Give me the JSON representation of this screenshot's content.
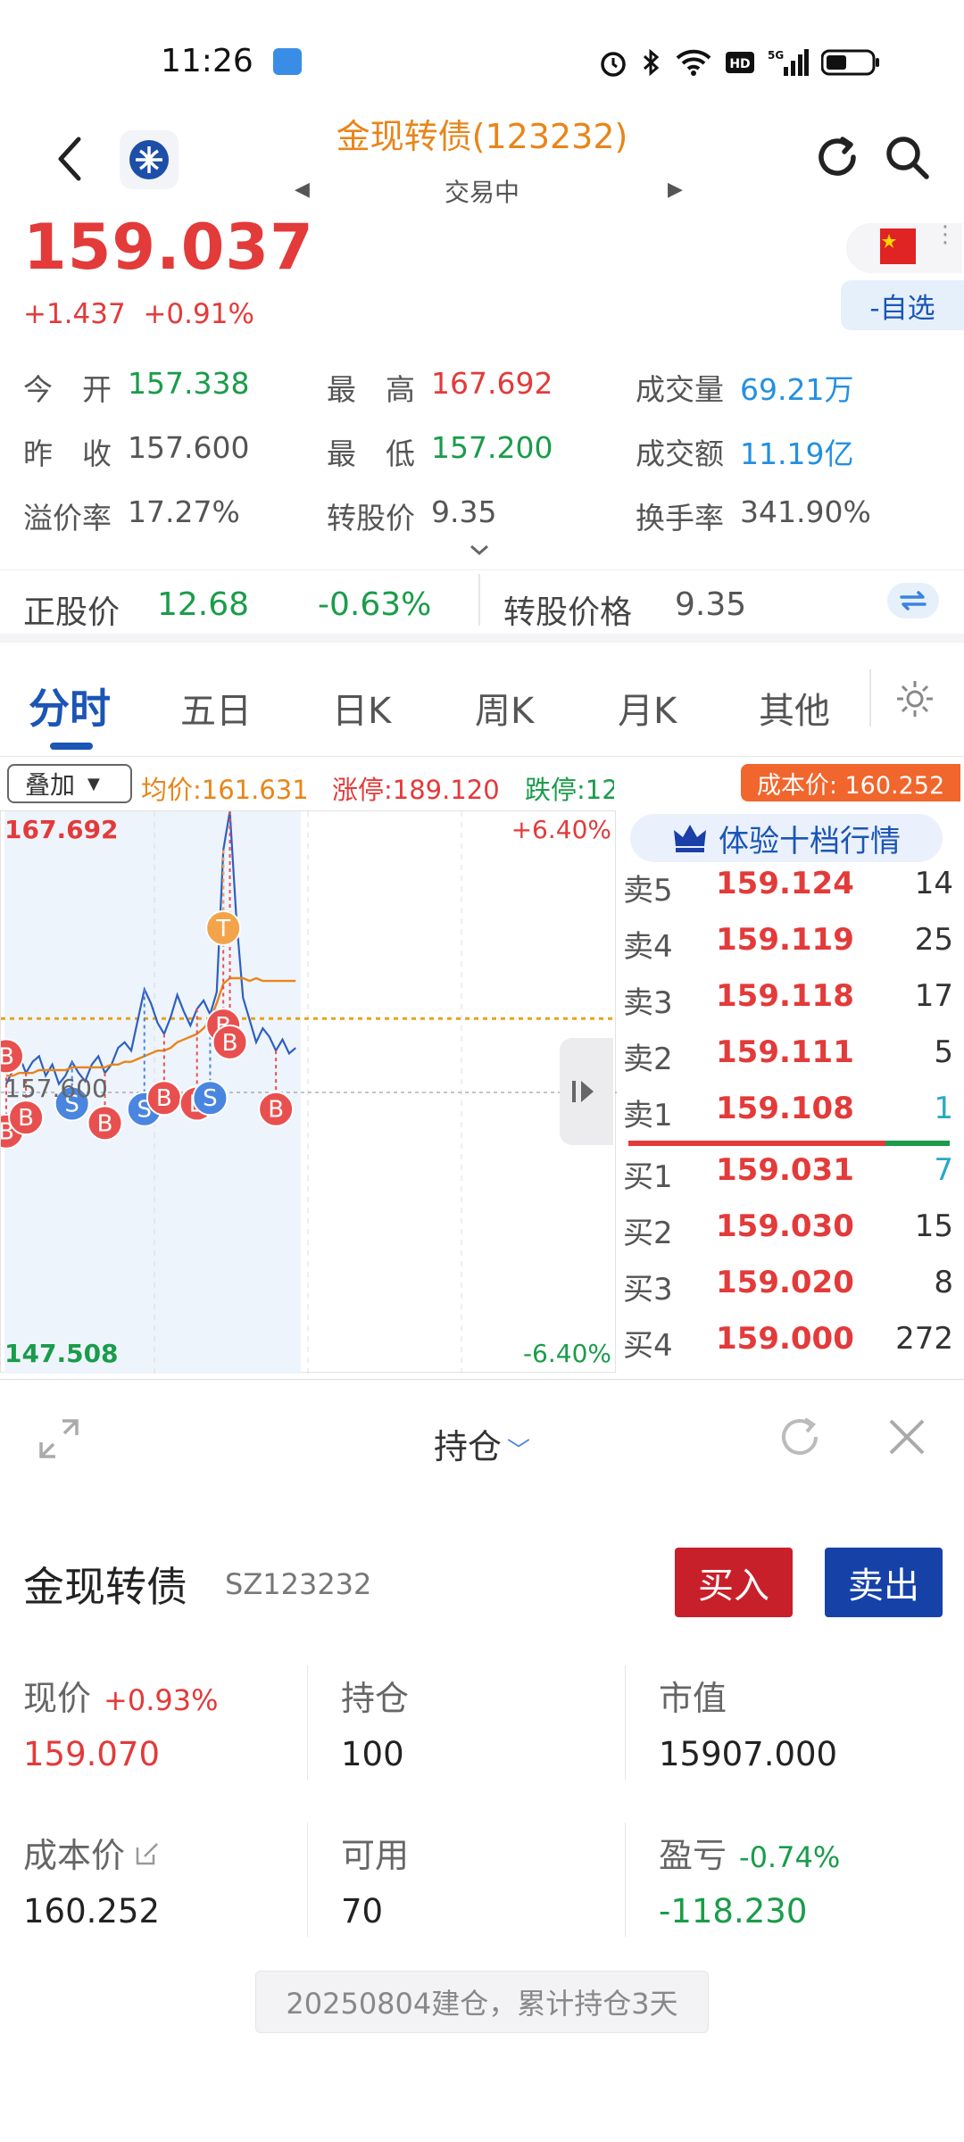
{
  "status_bar": {
    "time": "11:26"
  },
  "header": {
    "title": "金现转债(123232)",
    "subtitle": "交易中",
    "prev_arrow": "◀",
    "next_arrow": "▶"
  },
  "quote": {
    "price": "159.037",
    "change": "+1.437",
    "change_pct": "+0.91%",
    "watch_label": "-自选"
  },
  "stats": {
    "open_label": "今　开",
    "open": "157.338",
    "high_label": "最　高",
    "high": "167.692",
    "volume_label": "成交量",
    "volume": "69.21万",
    "prev_close_label": "昨　收",
    "prev_close": "157.600",
    "low_label": "最　低",
    "low": "157.200",
    "amount_label": "成交额",
    "amount": "11.19亿",
    "premium_label": "溢价率",
    "premium": "17.27%",
    "conv_price_label": "转股价",
    "conv_price": "9.35",
    "turnover_label": "换手率",
    "turnover": "341.90%"
  },
  "underlying": {
    "stock_price_label": "正股价",
    "stock_price": "12.68",
    "stock_change": "-0.63%",
    "conv_price_label": "转股价格",
    "conv_price": "9.35"
  },
  "tabs": [
    "分时",
    "五日",
    "日K",
    "周K",
    "月K",
    "其他"
  ],
  "chart_bar": {
    "overlay": "叠加",
    "avg_price": "均价:161.631",
    "limit_up": "涨停:189.120",
    "limit_down": "跌停:12",
    "cost_price": "成本价: 160.252"
  },
  "chart_data": {
    "type": "line",
    "y_max_label": "167.692",
    "y_min_label": "147.508",
    "y_mid_label": "157.600",
    "pct_max_label": "+6.40%",
    "pct_min_label": "-6.40%",
    "ylim": [
      147.508,
      167.692
    ],
    "reference": 157.6,
    "cost_line": 160.252,
    "series": [
      {
        "values": [
          157.9,
          158.4,
          158.9,
          158.3,
          158.7,
          158.9,
          158.2,
          158.6,
          157.9,
          158.2,
          158.7,
          158.3,
          158.0,
          158.6,
          158.9,
          158.3,
          158.6,
          159.2,
          159.4,
          159.1,
          160.2,
          161.3,
          160.8,
          160.1,
          159.7,
          160.3,
          161.1,
          160.5,
          160.0,
          160.6,
          160.9,
          160.4,
          161.2,
          166.3,
          167.69,
          163.8,
          161.0,
          160.2,
          159.4,
          159.9,
          159.6,
          159.1,
          159.5,
          159.0,
          159.2
        ]
      },
      {
        "values": [
          158.2,
          158.2,
          158.3,
          158.3,
          158.3,
          158.4,
          158.4,
          158.4,
          158.4,
          158.4,
          158.5,
          158.5,
          158.5,
          158.5,
          158.5,
          158.5,
          158.6,
          158.6,
          158.7,
          158.7,
          158.8,
          158.9,
          159.0,
          159.1,
          159.1,
          159.2,
          159.4,
          159.5,
          159.6,
          159.7,
          159.9,
          160.2,
          160.8,
          161.5,
          161.7,
          161.7,
          161.7,
          161.6,
          161.7,
          161.6,
          161.6,
          161.6,
          161.6,
          161.6,
          161.6
        ]
      }
    ],
    "markers": [
      {
        "label": "B",
        "i": 0,
        "y": 158.9,
        "color": "#e8504f"
      },
      {
        "label": "B",
        "i": 0,
        "y": 156.2,
        "color": "#e8504f"
      },
      {
        "label": "B",
        "i": 3,
        "y": 156.7,
        "color": "#e8504f"
      },
      {
        "label": "S",
        "i": 10,
        "y": 157.2,
        "color": "#4a86e0"
      },
      {
        "label": "B",
        "i": 15,
        "y": 156.5,
        "color": "#e8504f"
      },
      {
        "label": "S",
        "i": 21,
        "y": 157.0,
        "color": "#4a86e0"
      },
      {
        "label": "B",
        "i": 24,
        "y": 157.4,
        "color": "#e8504f"
      },
      {
        "label": "B",
        "i": 29,
        "y": 157.2,
        "color": "#e8504f"
      },
      {
        "label": "S",
        "i": 31,
        "y": 157.4,
        "color": "#4a86e0"
      },
      {
        "label": "B",
        "i": 33,
        "y": 160.0,
        "color": "#e8504f"
      },
      {
        "label": "B",
        "i": 34,
        "y": 159.4,
        "color": "#e8504f"
      },
      {
        "label": "T",
        "i": 33,
        "y": 163.5,
        "color": "#f3a44a"
      },
      {
        "label": "B",
        "i": 41,
        "y": 157.0,
        "color": "#e8504f"
      }
    ]
  },
  "order_book": {
    "banner": "体验十档行情",
    "asks": [
      {
        "side": "卖5",
        "price": "159.124",
        "vol": "14"
      },
      {
        "side": "卖4",
        "price": "159.119",
        "vol": "25"
      },
      {
        "side": "卖3",
        "price": "159.118",
        "vol": "17"
      },
      {
        "side": "卖2",
        "price": "159.111",
        "vol": "5"
      },
      {
        "side": "卖1",
        "price": "159.108",
        "vol": "1"
      }
    ],
    "bids": [
      {
        "side": "买1",
        "price": "159.031",
        "vol": "7"
      },
      {
        "side": "买2",
        "price": "159.030",
        "vol": "15"
      },
      {
        "side": "买3",
        "price": "159.020",
        "vol": "8"
      },
      {
        "side": "买4",
        "price": "159.000",
        "vol": "272"
      }
    ]
  },
  "position": {
    "title": "持仓",
    "name": "金现转债",
    "code": "SZ123232",
    "buy_label": "买入",
    "sell_label": "卖出",
    "cur_price_label": "现价",
    "cur_price_pct": "+0.93%",
    "cur_price": "159.070",
    "holding_label": "持仓",
    "holding": "100",
    "market_value_label": "市值",
    "market_value": "15907.000",
    "cost_label": "成本价",
    "cost": "160.252",
    "available_label": "可用",
    "available": "70",
    "pnl_label": "盈亏",
    "pnl_pct": "-0.74%",
    "pnl": "-118.230",
    "note": "20250804建仓，累计持仓3天"
  }
}
